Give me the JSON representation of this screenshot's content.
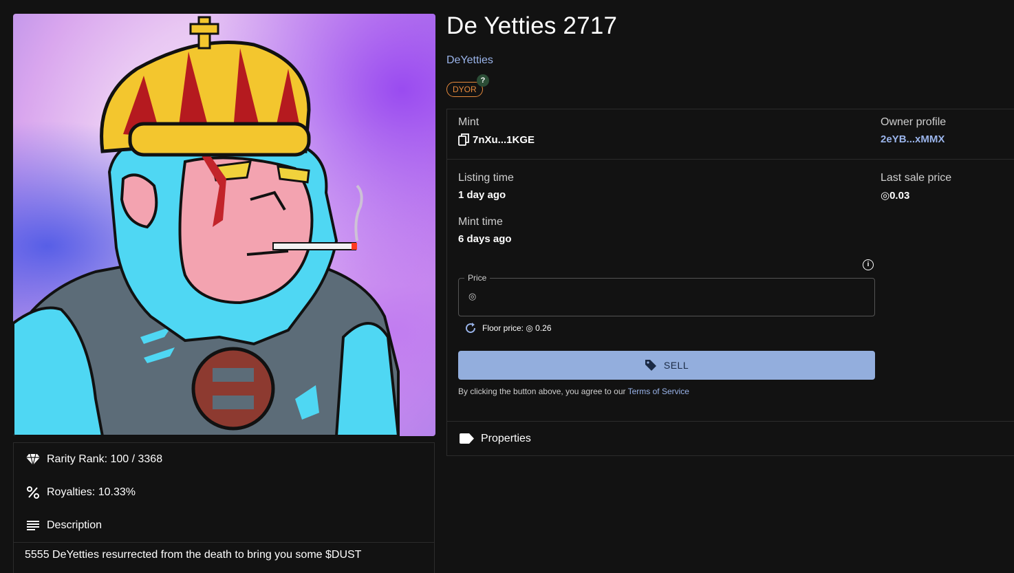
{
  "nft": {
    "title": "De Yetties 2717",
    "collection": "DeYetties",
    "badge": "DYOR",
    "badge_help": "?"
  },
  "details": {
    "mint_label": "Mint",
    "mint_value": "7nXu...1KGE",
    "owner_label": "Owner profile",
    "owner_value": "2eYB...xMMX",
    "listing_label": "Listing time",
    "listing_value": "1 day ago",
    "last_sale_label": "Last sale price",
    "last_sale_value": "◎0.03",
    "mint_time_label": "Mint time",
    "mint_time_value": "6 days ago"
  },
  "sell_form": {
    "price_label": "Price",
    "price_prefix": "◎",
    "price_value": "",
    "floor_price": "Floor price: ◎ 0.26",
    "sell_label": "SELL",
    "terms_text": "By clicking the button above, you agree to our ",
    "terms_link": "Terms of Service"
  },
  "properties": {
    "label": "Properties"
  },
  "info": {
    "rarity": "Rarity Rank: 100 / 3368",
    "royalties": "Royalties: 10.33%",
    "description_label": "Description",
    "description_text": "5555 DeYetties resurrected from the death to bring you some $DUST"
  },
  "colors": {
    "background": "#121212",
    "accent_link": "#9ab4ea",
    "sell_button": "#93aedd",
    "badge": "#e98b3c"
  },
  "icons": {
    "copy": "copy-icon",
    "refresh": "refresh-icon",
    "tag": "tag-icon",
    "label": "label-icon",
    "diamond": "diamond-icon",
    "percent": "percent-icon",
    "description": "description-icon",
    "info": "info-icon"
  }
}
